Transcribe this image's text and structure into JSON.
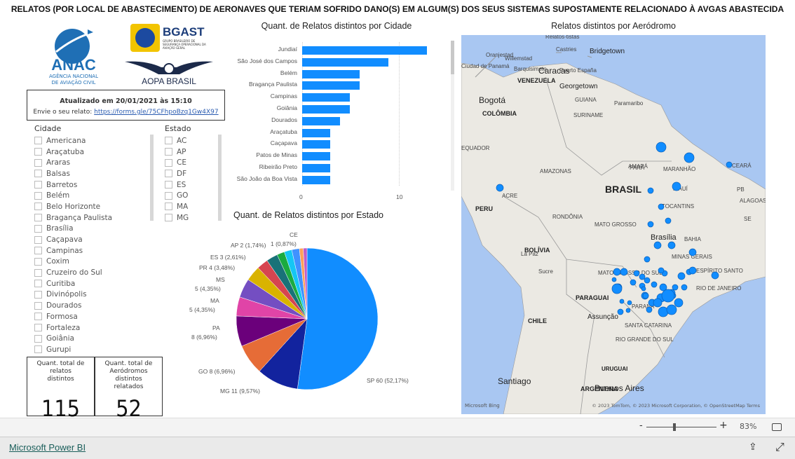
{
  "title": "RELATOS (POR LOCAL DE ABASTECIMENTO) DE AERONAVES QUE TERIAM SOFRIDO DANO(S) EM ALGUM(S) DOS SEUS SISTEMAS SUPOSTAMENTE RELACIONADO À AVGAS ABASTECIDA",
  "logos": {
    "anac": "ANAC",
    "anac_sub1": "AGÊNCIA NACIONAL",
    "anac_sub2": "DE AVIAÇÃO CIVIL",
    "bgast": "BGAST",
    "bgast_sub": "GRUPO BRASILEIRO DE SEGURANÇA OPERACIONAL DA AVIAÇÃO GERAL",
    "aopa": "AOPA BRASIL"
  },
  "info": {
    "updated": "Atualizado em 20/01/2021 às 15:10",
    "send_label": "Envie o seu relato:",
    "link": "https://forms.gle/75CFhpoBzq1Gw4X97"
  },
  "slicers": {
    "cidade": {
      "header": "Cidade",
      "items": [
        "Americana",
        "Araçatuba",
        "Araras",
        "Balsas",
        "Barretos",
        "Belém",
        "Belo Horizonte",
        "Bragança Paulista",
        "Brasília",
        "Caçapava",
        "Campinas",
        "Coxim",
        "Cruzeiro do Sul",
        "Curitiba",
        "Divinópolis",
        "Dourados",
        "Formosa",
        "Fortaleza",
        "Goiânia",
        "Gurupi"
      ]
    },
    "estado": {
      "header": "Estado",
      "items": [
        "AC",
        "AP",
        "CE",
        "DF",
        "ES",
        "GO",
        "MA",
        "MG"
      ]
    }
  },
  "cards": [
    {
      "label": "Quant. total de relatos distintos",
      "value": "115"
    },
    {
      "label": "Quant. total de Aeródromos distintos relatados",
      "value": "52"
    }
  ],
  "chart_data": [
    {
      "type": "bar",
      "orientation": "horizontal",
      "title": "Quant. de Relatos distintos por Cidade",
      "categories": [
        "Jundiaí",
        "São José dos Campos",
        "Belém",
        "Bragança Paulista",
        "Campinas",
        "Goiânia",
        "Dourados",
        "Araçatuba",
        "Caçapava",
        "Patos de Minas",
        "Ribeirão Preto",
        "São João da Boa Vista"
      ],
      "values": [
        13,
        9,
        6,
        6,
        5,
        5,
        4,
        3,
        3,
        3,
        3,
        3
      ],
      "xticks": [
        "0",
        "10"
      ],
      "xlim": [
        0,
        14
      ],
      "color": "#118dff",
      "grid": true
    },
    {
      "type": "pie",
      "title": "Quant. de Relatos distintos por Estado",
      "slices": [
        {
          "name": "SP",
          "value": 60,
          "label": "SP 60 (52,17%)",
          "color": "#118dff"
        },
        {
          "name": "MG",
          "value": 11,
          "label": "MG 11 (9,57%)",
          "color": "#12239e"
        },
        {
          "name": "GO",
          "value": 8,
          "label": "GO 8 (6,96%)",
          "color": "#e66c37"
        },
        {
          "name": "PA",
          "value": 8,
          "label": "PA",
          "label2": "8 (6,96%)",
          "color": "#6b007b"
        },
        {
          "name": "MA",
          "value": 5,
          "label": "MA",
          "label2": "5 (4,35%)",
          "color": "#e044a7"
        },
        {
          "name": "MS",
          "value": 5,
          "label": "MS",
          "label2": "5 (4,35%)",
          "color": "#744ec2"
        },
        {
          "name": "PR",
          "value": 4,
          "label": "PR 4 (3,48%)",
          "color": "#d9b300"
        },
        {
          "name": "ES",
          "value": 3,
          "label": "ES 3 (2,61%)",
          "color": "#d64550"
        },
        {
          "value": 3,
          "color": "#197278"
        },
        {
          "name": "AP",
          "value": 2,
          "label": "AP 2 (1,74%)",
          "color": "#1aab40"
        },
        {
          "value": 2,
          "label": "1 (0,87%)",
          "color": "#15c6f4"
        },
        {
          "value": 2,
          "color": "#4092ff"
        },
        {
          "value": 1,
          "color": "#ffa058"
        },
        {
          "name": "CE",
          "value": 1,
          "label": "CE",
          "color": "#be5dc9"
        }
      ]
    }
  ],
  "map": {
    "title": "Relatos distintos por Aeródromo",
    "bubble_color": "#118dff",
    "attribution": "© 2023 TomTom, © 2023 Microsoft Corporation, © OpenStreetMap  Terms",
    "bing": "Microsoft Bing",
    "labels": [
      "Relatos-tistas",
      "Oranjestad",
      "Willemstad",
      "Castries",
      "Bridgetown",
      "Ciudad de Panamá",
      "Barquisimeto",
      "Caracas",
      "Puerto España",
      "VENEZUELA",
      "Georgetown",
      "Bogotá",
      "COLÔMBIA",
      "GUIANA",
      "SURINAME",
      "Paramaribo",
      "AMAPÁ",
      "EQUADOR",
      "AMAZONAS",
      "PARÁ",
      "MARANHÃO",
      "CEARÁ",
      "BRASIL",
      "PIAUÍ",
      "PB",
      "ALAGOAS",
      "SE",
      "ACRE",
      "PERU",
      "RONDÔNIA",
      "TOCANTINS",
      "BAHIA",
      "MATO GROSSO",
      "Brasília",
      "La Paz",
      "BOLÍVIA",
      "MINAS GERAIS",
      "Sucre",
      "MATO GROSSO DO SUL",
      "ESPÍRITO SANTO",
      "PARAGUAI",
      "RIO DE JANEIRO",
      "PARANÁ",
      "Assunção",
      "SANTA CATARINA",
      "CHILE",
      "RIO GRANDE DO SUL",
      "Santiago",
      "URUGUAI",
      "ARGENTINA",
      "Buenos Aires"
    ]
  },
  "toolbar": {
    "zoom_minus": "-",
    "zoom_plus": "+",
    "zoom_level": "83%",
    "zoom_value": 83
  },
  "footer": {
    "powerbi": "Microsoft Power BI"
  }
}
